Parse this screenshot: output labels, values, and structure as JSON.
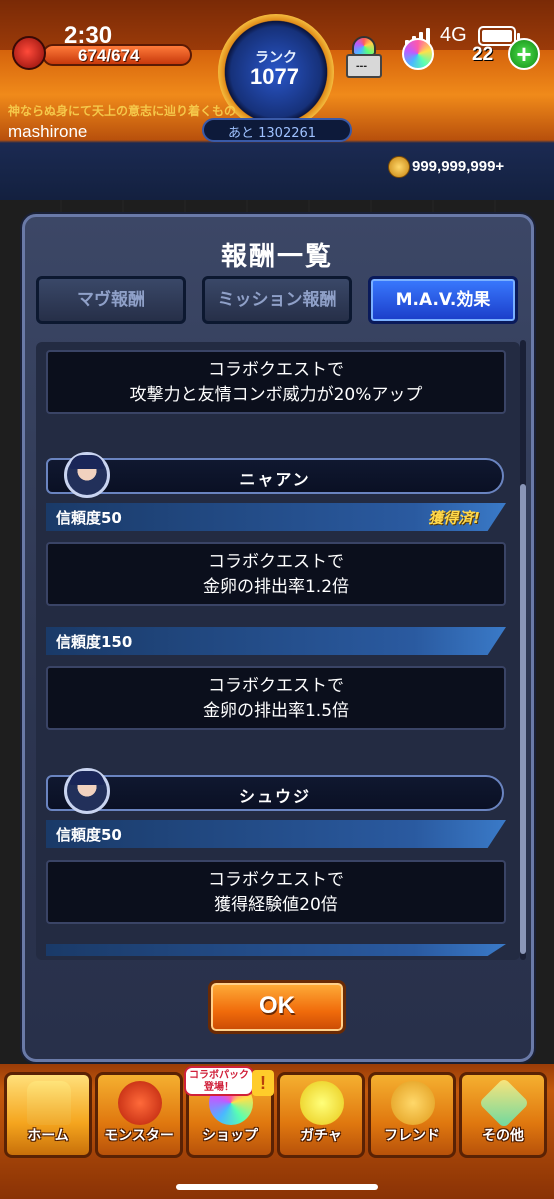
{
  "status_bar": {
    "time": "2:30",
    "network": "4G"
  },
  "header": {
    "hp": "674/674",
    "rank_label": "ランク",
    "rank_value": "1077",
    "box_text": "---",
    "orb_count": "22",
    "plus_label": "+",
    "title": "神ならぬ身にて天上の意志に辿り着くもの",
    "player_name": "mashirone",
    "next_exp": "あと 1302261",
    "coins": "999,999,999+"
  },
  "modal": {
    "title": "報酬一覧",
    "tabs": [
      {
        "label": "マヴ報酬"
      },
      {
        "label": "ミッション報酬"
      },
      {
        "label": "M.A.V.効果"
      }
    ],
    "top_effect": {
      "line1": "コラボクエストで",
      "line2": "攻撃力と友情コンボ威力が20%アップ"
    },
    "characters": [
      {
        "name": "ニャアン",
        "rewards": [
          {
            "trust": "信頼度50",
            "status": "獲得済!",
            "line1": "コラボクエストで",
            "line2": "金卵の排出率1.2倍"
          },
          {
            "trust": "信頼度150",
            "status": "",
            "line1": "コラボクエストで",
            "line2": "金卵の排出率1.5倍"
          }
        ]
      },
      {
        "name": "シュウジ",
        "rewards": [
          {
            "trust": "信頼度50",
            "status": "",
            "line1": "コラボクエストで",
            "line2": "獲得経験値20倍"
          }
        ]
      }
    ],
    "ok_label": "OK"
  },
  "nav": {
    "items": [
      {
        "label": "ホーム"
      },
      {
        "label": "モンスター"
      },
      {
        "label": "ショップ"
      },
      {
        "label": "ガチャ"
      },
      {
        "label": "フレンド"
      },
      {
        "label": "その他"
      }
    ],
    "shop_badge_line1": "コラボパック",
    "shop_badge_line2": "登場！",
    "exclaim": "!"
  }
}
